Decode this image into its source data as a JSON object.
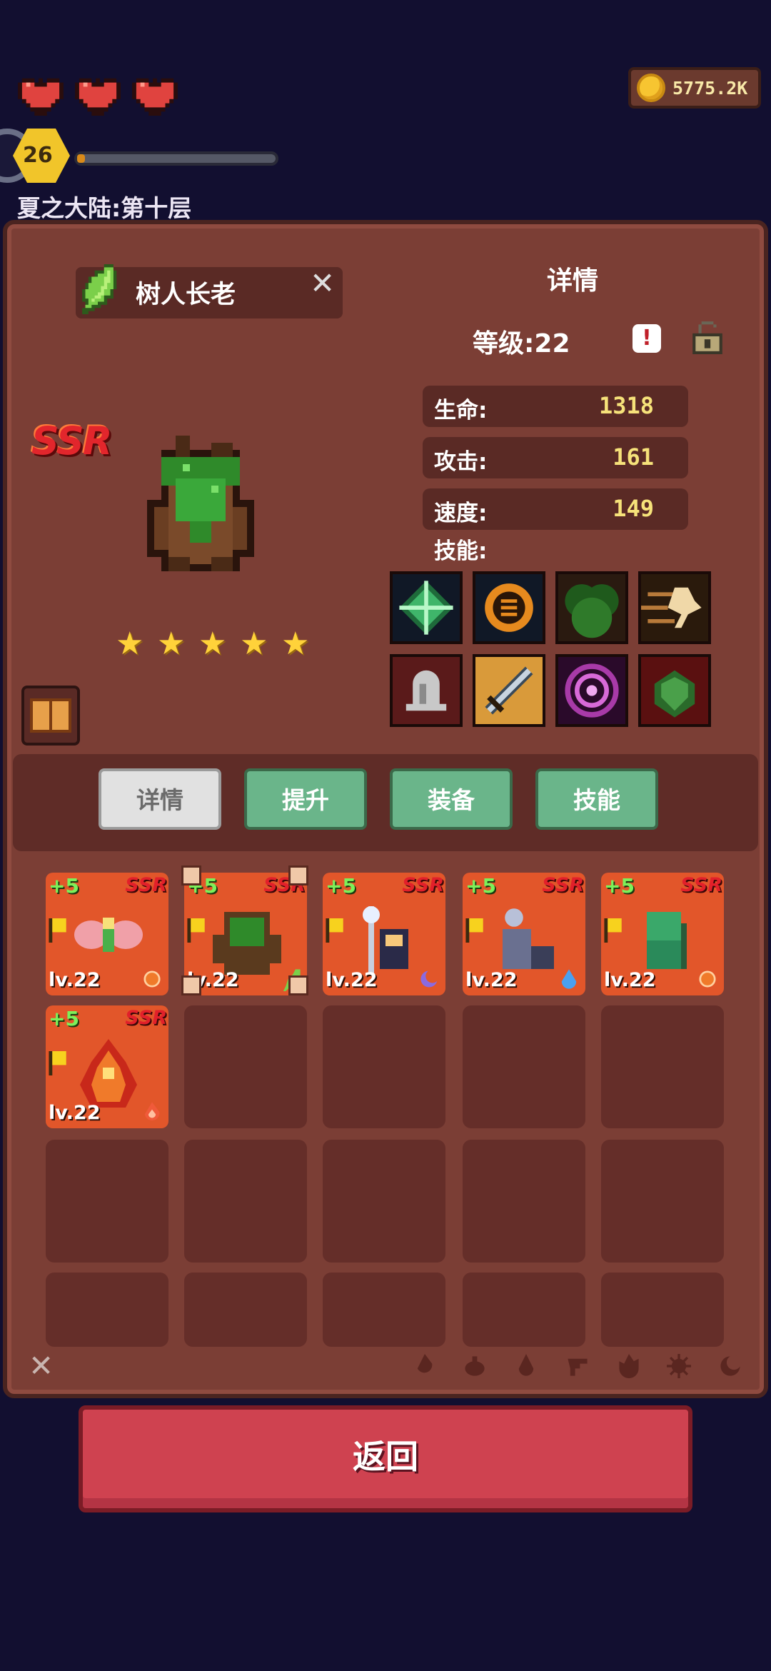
{
  "hud": {
    "hearts": 3,
    "coins": "5775.2K",
    "player_level": "26",
    "xp_fraction": 0.04,
    "stage": "夏之大陆:第十层"
  },
  "hero": {
    "name": "树人长老",
    "rarity": "SSR",
    "stars": 5,
    "detail_title": "详情",
    "level_label": "等级:22",
    "stats": [
      {
        "label": "生命:",
        "value": "1318"
      },
      {
        "label": "攻击:",
        "value": "161"
      },
      {
        "label": "速度:",
        "value": "149"
      }
    ],
    "skills_label": "技能:",
    "skills": [
      "green-crystal-icon",
      "orange-rune-icon",
      "bush-icon",
      "speed-dash-icon",
      "bell-icon",
      "sword-icon",
      "purple-vortex-icon",
      "cabbage-icon"
    ]
  },
  "tabs": [
    {
      "label": "详情",
      "active": true
    },
    {
      "label": "提升",
      "active": false
    },
    {
      "label": "装备",
      "active": false
    },
    {
      "label": "技能",
      "active": false
    }
  ],
  "roster": [
    {
      "plus": "+5",
      "rarity": "SSR",
      "level": "lv.22",
      "element": "sun",
      "sprite": "fairy"
    },
    {
      "plus": "+5",
      "rarity": "SSR",
      "level": "lv.22",
      "element": "leaf",
      "sprite": "treant",
      "selected": true
    },
    {
      "plus": "+5",
      "rarity": "SSR",
      "level": "lv.22",
      "element": "moon",
      "sprite": "mage"
    },
    {
      "plus": "+5",
      "rarity": "SSR",
      "level": "lv.22",
      "element": "water",
      "sprite": "knight"
    },
    {
      "plus": "+5",
      "rarity": "SSR",
      "level": "lv.22",
      "element": "sun",
      "sprite": "goblin"
    },
    {
      "plus": "+5",
      "rarity": "SSR",
      "level": "lv.22",
      "element": "fire",
      "sprite": "fire-spirit"
    }
  ],
  "filters": [
    "flame-icon",
    "leaf-icon",
    "drop-icon",
    "wind-icon",
    "fire-icon",
    "sun-icon",
    "moon-icon"
  ],
  "back_button": "返回",
  "colors": {
    "background": "#120f30",
    "panel": "#7b3e35",
    "tab_green": "#6ab58a",
    "card_orange": "#e2562a",
    "back_red": "#cf4250"
  }
}
